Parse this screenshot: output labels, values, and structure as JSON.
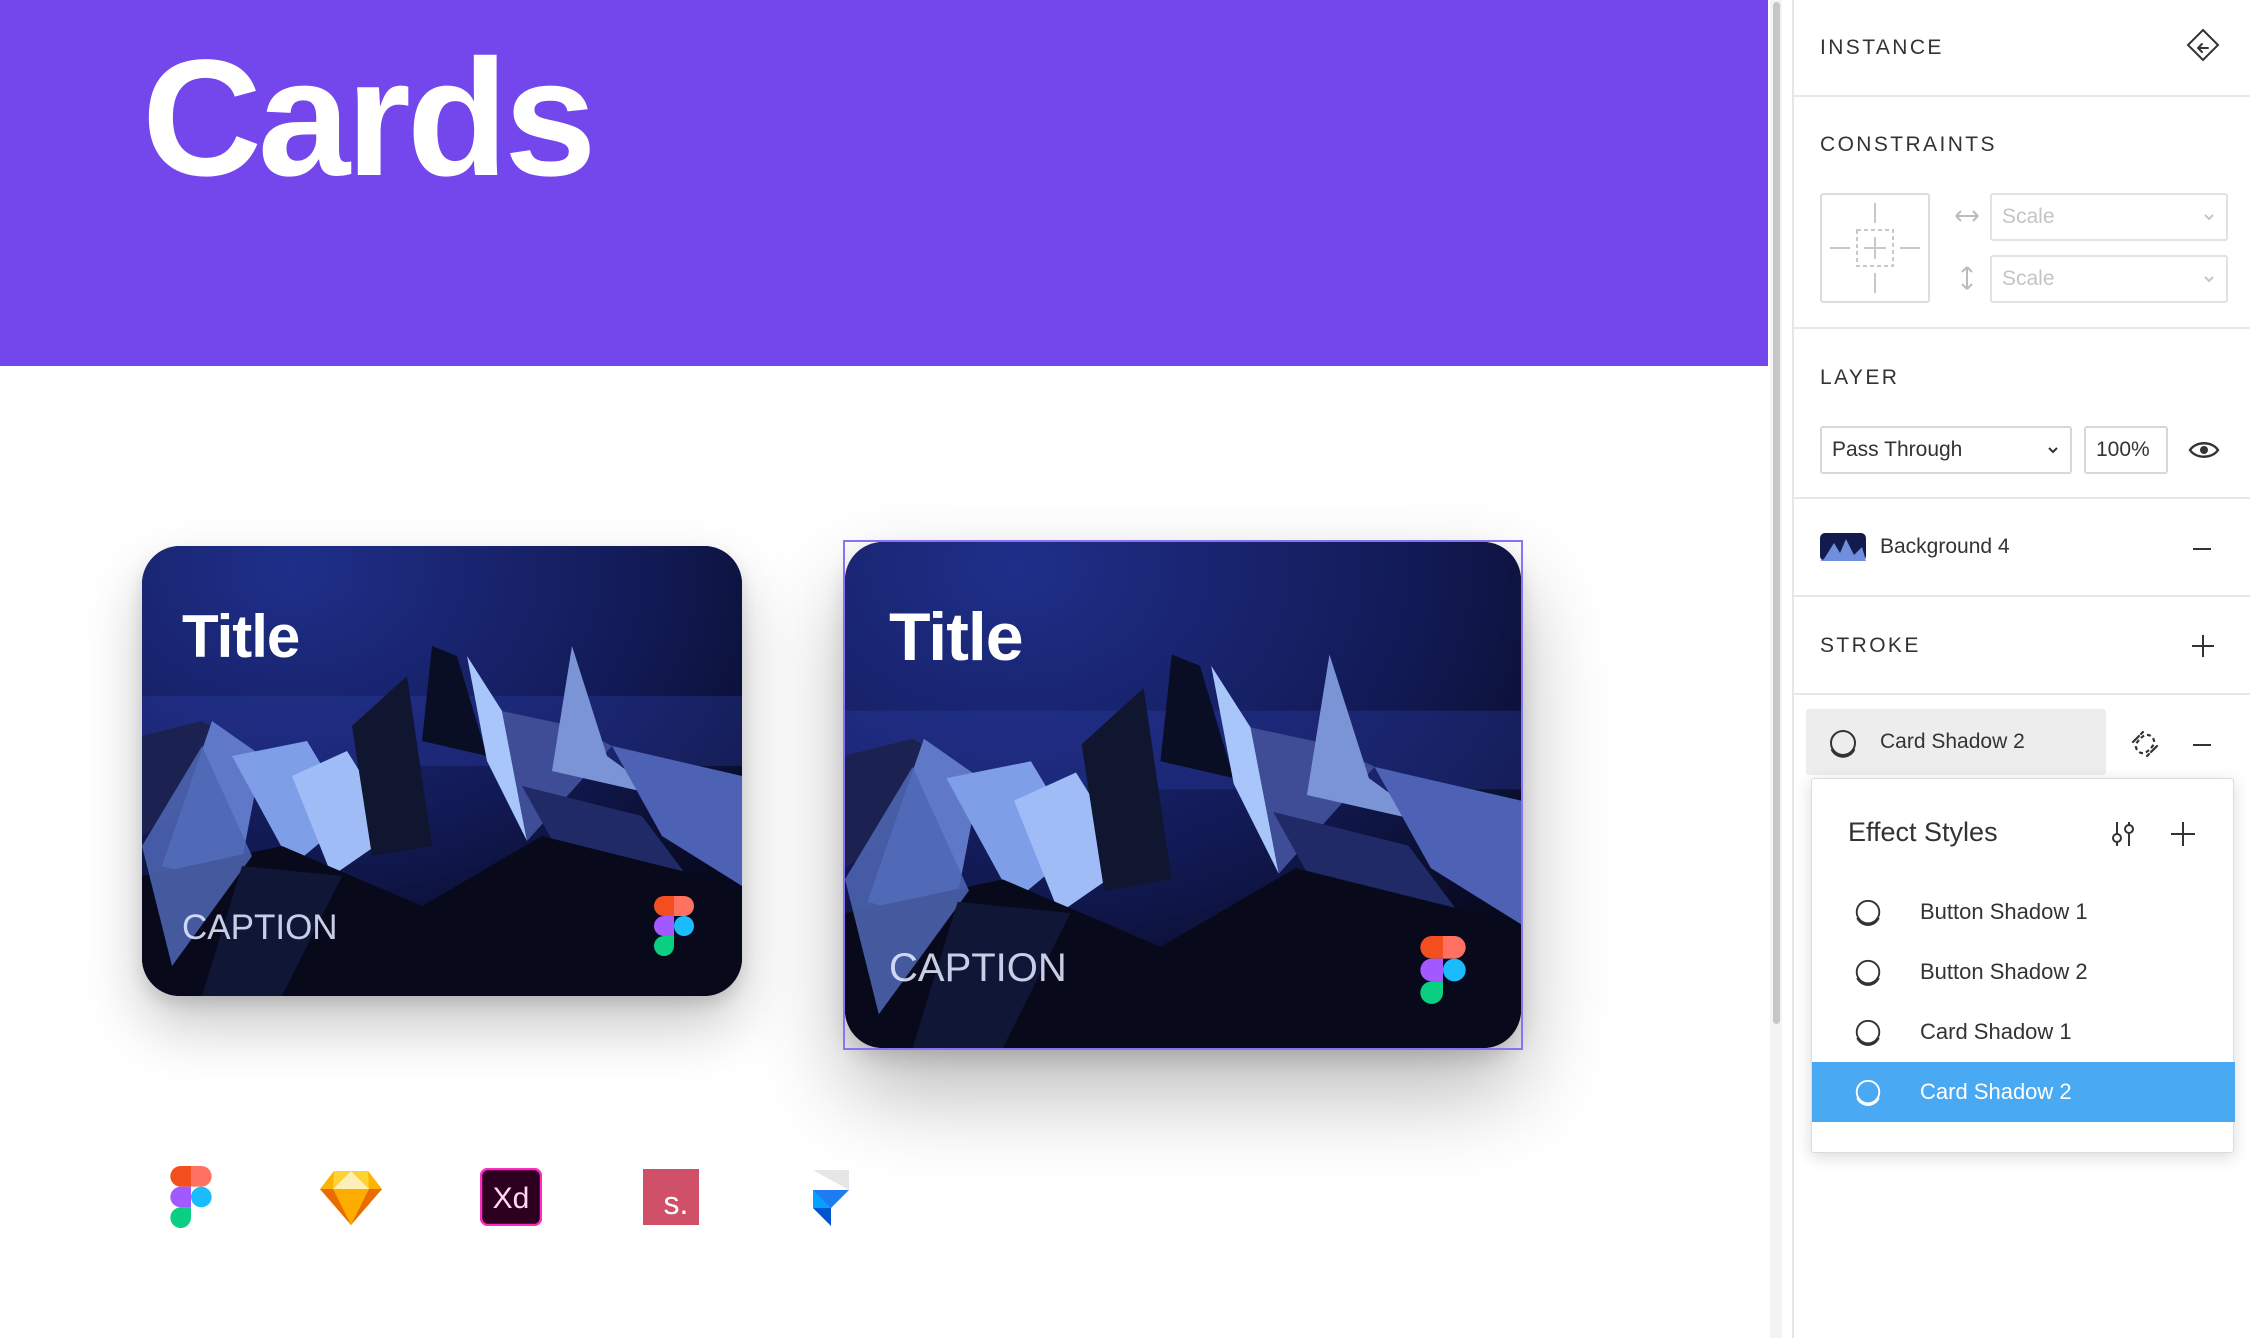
{
  "canvas": {
    "hero_title": "Cards",
    "hero_color": "#7447ec",
    "cards": [
      {
        "title": "Title",
        "caption": "CAPTION",
        "badge": "figma-logo-icon"
      },
      {
        "title": "Title",
        "caption": "CAPTION",
        "badge": "figma-logo-icon",
        "selected": true
      }
    ],
    "tools": [
      "figma-logo-icon",
      "sketch-logo-icon",
      "adobe-xd-logo-icon",
      "studio-logo-icon",
      "framer-logo-icon"
    ],
    "xd_label": "Xd",
    "studio_label": "s."
  },
  "panel": {
    "instance": {
      "heading": "INSTANCE",
      "icon": "detach-instance-icon"
    },
    "constraints": {
      "heading": "CONSTRAINTS",
      "horizontal": {
        "value": "Scale",
        "icon": "horizontal-arrow-icon"
      },
      "vertical": {
        "value": "Scale",
        "icon": "vertical-arrow-icon"
      }
    },
    "layer": {
      "heading": "LAYER",
      "blend_mode": "Pass Through",
      "opacity": "100%",
      "visibility_icon": "eye-icon"
    },
    "fill": {
      "style_name": "Background 4",
      "remove_icon": "minus-icon"
    },
    "stroke": {
      "heading": "STROKE",
      "add_icon": "plus-icon"
    },
    "effect": {
      "style_name": "Card Shadow 2",
      "detach_icon": "detach-style-icon",
      "remove_icon": "minus-icon"
    },
    "effect_styles": {
      "heading": "Effect Styles",
      "settings_icon": "adjust-icon",
      "add_icon": "plus-icon",
      "items": [
        {
          "label": "Button Shadow 1",
          "active": false
        },
        {
          "label": "Button Shadow 2",
          "active": false
        },
        {
          "label": "Card Shadow 1",
          "active": false
        },
        {
          "label": "Card Shadow 2",
          "active": true
        }
      ],
      "active_color": "#4aa9f3"
    }
  }
}
